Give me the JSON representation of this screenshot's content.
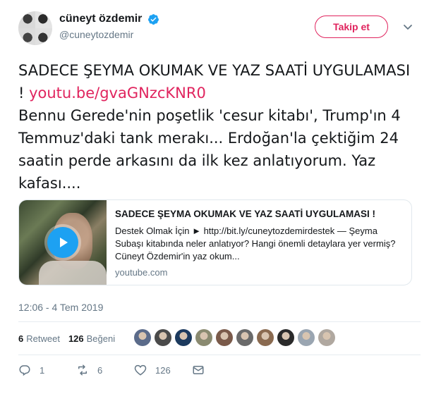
{
  "user": {
    "display_name": "cüneyt özdemir",
    "handle": "@cuneytozdemir",
    "verified": true
  },
  "follow_button": {
    "label": "Takip et"
  },
  "tweet": {
    "text_before_link": "SADECE ŞEYMA OKUMAK VE YAZ SAATİ UYGULAMASI ! ",
    "link": "youtu.be/gvaGNzcKNR0",
    "text_after_link": "Bennu Gerede'nin poşetlik 'cesur kitabı', Trump'ın 4 Temmuz'daki tank merakı... Erdoğan'la çektiğim 24 saatin perde arkasını da ilk kez anlatıyorum. Yaz kafası...."
  },
  "card": {
    "title": "SADECE ŞEYMA OKUMAK VE YAZ SAATİ UYGULAMASI !",
    "description": "Destek Olmak İçin ► http://bit.ly/cuneytozdemirdestek — Şeyma Subaşı kitabında neler anlatıyor? Hangi önemli detaylara yer vermiş? Cüneyt Özdemir'in yaz okum...",
    "domain": "youtube.com"
  },
  "timestamp": "12:06 - 4 Tem 2019",
  "stats": {
    "retweets_count": "6",
    "retweets_label": "Retweet",
    "likes_count": "126",
    "likes_label": "Beğeni"
  },
  "likers": [
    {
      "color": "#5b6b8a"
    },
    {
      "color": "#4a4a4a"
    },
    {
      "color": "#1c3a5e"
    },
    {
      "color": "#8a8a70"
    },
    {
      "color": "#7a5a4a"
    },
    {
      "color": "#6a6a6a"
    },
    {
      "color": "#8a6a50"
    },
    {
      "color": "#2a2a2a"
    },
    {
      "color": "#9aa5b1"
    },
    {
      "color": "#b0a8a0"
    }
  ],
  "actions": {
    "reply_count": "1",
    "retweet_count": "6",
    "like_count": "126"
  },
  "colors": {
    "accent": "#e0245e",
    "verified": "#1da1f2",
    "muted": "#657786",
    "text": "#14171a",
    "divider": "#e6ecf0"
  },
  "icons": [
    "verified-icon",
    "chevron-down-icon",
    "play-icon",
    "reply-icon",
    "retweet-icon",
    "like-icon",
    "message-icon"
  ]
}
